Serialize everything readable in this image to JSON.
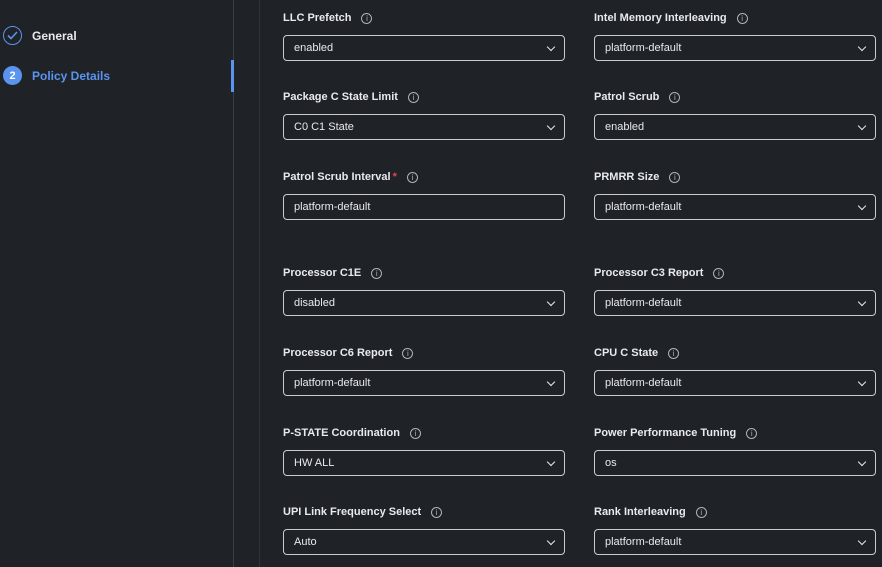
{
  "steps": [
    {
      "number": "1",
      "label": "General",
      "status": "done"
    },
    {
      "number": "2",
      "label": "Policy Details",
      "status": "active"
    }
  ],
  "fields": [
    {
      "label": "LLC Prefetch",
      "value": "enabled",
      "type": "select"
    },
    {
      "label": "Intel Memory Interleaving",
      "value": "platform-default",
      "type": "select"
    },
    {
      "label": "Package C State Limit",
      "value": "C0 C1 State",
      "type": "select"
    },
    {
      "label": "Patrol Scrub",
      "value": "enabled",
      "type": "select"
    },
    {
      "label": "Patrol Scrub Interval",
      "required": "*",
      "value": "platform-default",
      "type": "input"
    },
    {
      "label": "PRMRR Size",
      "value": "platform-default",
      "type": "select"
    },
    {
      "label": "Processor C1E",
      "value": "disabled",
      "type": "select"
    },
    {
      "label": "Processor C3 Report",
      "value": "platform-default",
      "type": "select"
    },
    {
      "label": "Processor C6 Report",
      "value": "platform-default",
      "type": "select"
    },
    {
      "label": "CPU C State",
      "value": "platform-default",
      "type": "select"
    },
    {
      "label": "P-STATE Coordination",
      "value": "HW ALL",
      "type": "select"
    },
    {
      "label": "Power Performance Tuning",
      "value": "os",
      "type": "select"
    },
    {
      "label": "UPI Link Frequency Select",
      "value": "Auto",
      "type": "select"
    },
    {
      "label": "Rank Interleaving",
      "value": "platform-default",
      "type": "select"
    }
  ],
  "info_glyph": "i",
  "accent": "#5b94ee"
}
